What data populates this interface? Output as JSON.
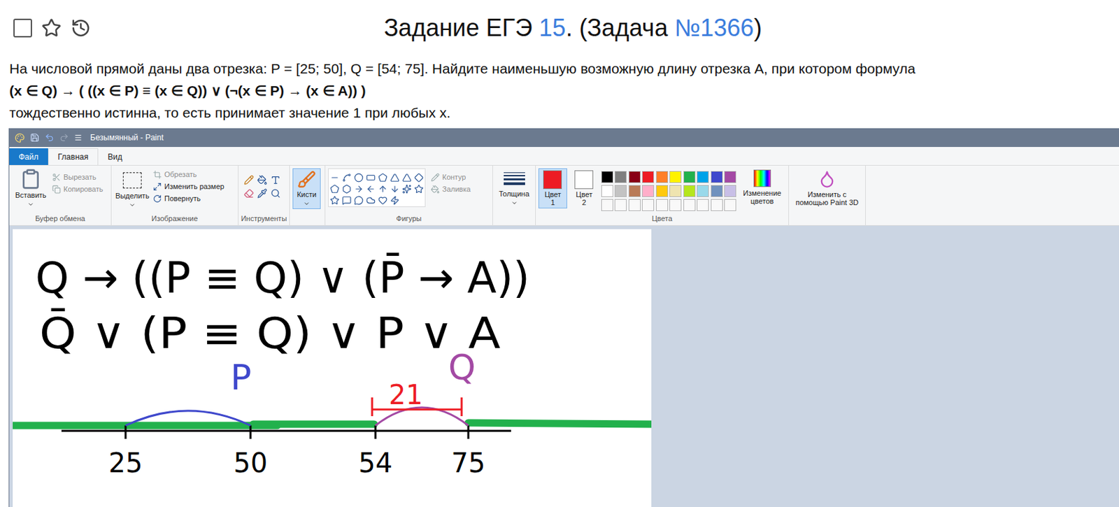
{
  "header": {
    "checkbox": false,
    "title_parts": [
      {
        "text": "Задание ЕГЭ ",
        "link": false
      },
      {
        "text": "15",
        "link": true
      },
      {
        "text": ". (Задача ",
        "link": false
      },
      {
        "text": "№1366",
        "link": true
      },
      {
        "text": ")",
        "link": false
      }
    ]
  },
  "problem": {
    "lines": [
      {
        "text": "На числовой прямой даны два отрезка: P = [25; 50], Q = [54; 75]. Найдите наименьшую возможную длину отрезка A, при котором формула",
        "bold": false
      },
      {
        "text": "(x ∈ Q) → ( ((x ∈ P) ≡ (x ∈ Q)) ∨ (¬(x ∈ P) → (x ∈ A)) )",
        "bold": true
      },
      {
        "text": "тождественно истинна, то есть принимает значение 1 при любых x.",
        "bold": false
      }
    ]
  },
  "paint": {
    "window": {
      "title": "Безымянный - Paint"
    },
    "tabs": [
      {
        "label": "Файл",
        "selected": false,
        "kind": "file"
      },
      {
        "label": "Главная",
        "selected": true,
        "kind": "tab"
      },
      {
        "label": "Вид",
        "selected": false,
        "kind": "tab"
      }
    ],
    "clipboard": {
      "label": "Буфер обмена",
      "paste": "Вставить",
      "cut": {
        "text": "Вырезать",
        "disabled": true
      },
      "copy": {
        "text": "Копировать",
        "disabled": true
      }
    },
    "image": {
      "label": "Изображение",
      "select": "Выделить",
      "crop": {
        "text": "Обрезать",
        "disabled": true
      },
      "resize": {
        "text": "Изменить размер",
        "disabled": false
      },
      "rotate": {
        "text": "Повернуть",
        "disabled": false
      }
    },
    "tools": {
      "label": "Инструменты"
    },
    "brushes": {
      "label": "Кисти",
      "selected": true
    },
    "shapes": {
      "label": "Фигуры",
      "outline": {
        "text": "Контур",
        "disabled": true
      },
      "fill": {
        "text": "Заливка",
        "disabled": true
      }
    },
    "size": {
      "label": "Толщина"
    },
    "colors": {
      "label": "Цвета",
      "color1": {
        "label": "Цвет 1",
        "value": "#ed1c24",
        "selected": true
      },
      "color2": {
        "label": "Цвет 2",
        "value": "#ffffff",
        "selected": false
      },
      "palette": [
        "#000000",
        "#7f7f7f",
        "#880015",
        "#ed1c24",
        "#ff7f27",
        "#fff200",
        "#22b14c",
        "#00a2e8",
        "#3f48cc",
        "#a349a4",
        "#ffffff",
        "#c3c3c3",
        "#b97a57",
        "#ffaec9",
        "#ffc90e",
        "#efe4b0",
        "#b5e61d",
        "#99d9ea",
        "#7092be",
        "#c8bfe7",
        null,
        null,
        null,
        null,
        null,
        null,
        null,
        null,
        null,
        null
      ],
      "edit": "Изменение цветов"
    },
    "paint3d": {
      "label": "Изменить с помощью Paint 3D"
    },
    "canvas": {
      "formula_lines": [
        "Q → ((P ≡ Q) ∨ (P̄ → A))",
        "Q̄ ∨ (P ≡ Q) ∨ P ∨ A"
      ],
      "ticks": [
        "25",
        "50",
        "54",
        "75"
      ],
      "segments": [
        {
          "label": "P",
          "from": "25",
          "to": "50",
          "color": "#3f48cc"
        },
        {
          "label": "Q",
          "from": "54",
          "to": "75",
          "color": "#a349a4"
        }
      ],
      "answer": {
        "label": "21",
        "from": "54",
        "to": "75",
        "color": "#ed1c24"
      },
      "cover_color": "#22b14c"
    }
  }
}
